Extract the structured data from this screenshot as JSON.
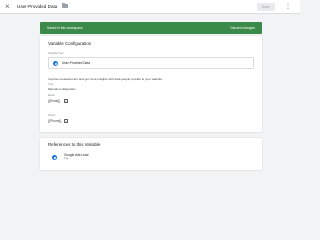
{
  "header": {
    "title": "User-Provided Data",
    "save_label": "Save",
    "close_icon": "close-icon",
    "folder_icon": "folder-icon",
    "more_icon": "more-vert-icon"
  },
  "banner": {
    "text": "Saved in this workspace",
    "link": "Discard changes",
    "color": "#3c8a49"
  },
  "config": {
    "heading": "Variable Configuration",
    "type_label": "Variable Type",
    "type_value": "User-Provided Data",
    "description": "Improve measurement and get more insights with data people provide to your website.",
    "type_section_label": "Type",
    "type_section_value": "Manual configuration",
    "email_label": "Email",
    "email_value": "{{Email}}",
    "phone_label": "Phone",
    "phone_value": "{{Phone}}"
  },
  "refs": {
    "heading": "References to this Variable",
    "items": [
      {
        "name": "Google Ads Lead",
        "type": "Tag"
      }
    ]
  },
  "colors": {
    "accent": "#1a73e8",
    "banner": "#3c8a49",
    "background": "#f1f3f4"
  }
}
